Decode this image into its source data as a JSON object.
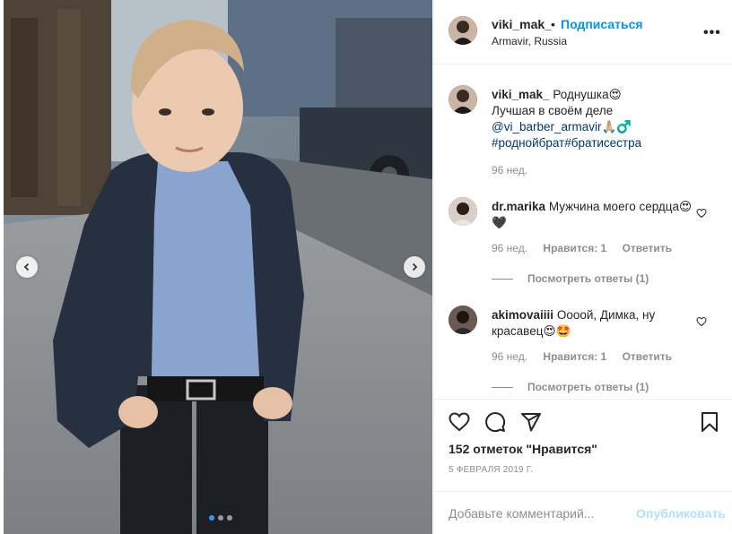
{
  "post": {
    "username": "viki_mak_",
    "separator": "•",
    "follow_label": "Подписаться",
    "location": "Armavir, Russia",
    "more_label": "•••"
  },
  "caption": {
    "username": "viki_mak_",
    "line1": "Роднушка😍",
    "line2": "Лучшая в своём деле",
    "mention": "@vi_barber_armavir",
    "mention_emoji": "🙏🏼♂️",
    "hashtags": "#роднойбрат#братисестра",
    "time": "96 нед."
  },
  "comments": [
    {
      "username": "dr.marika",
      "text": "Мужчина моего сердца😍🖤",
      "time": "96 нед.",
      "likes": "Нравится: 1",
      "reply": "Ответить",
      "view_replies": "Посмотреть ответы (1)"
    },
    {
      "username": "akimovaiiii",
      "text": "Оооой, Димка, ну красавец😍🤩",
      "time": "96 нед.",
      "likes": "Нравится: 1",
      "reply": "Ответить",
      "view_replies": "Посмотреть ответы (1)"
    }
  ],
  "stats": {
    "likes": "152 отметок \"Нравится\"",
    "date": "5 ФЕВРАЛЯ 2019 Г."
  },
  "composer": {
    "placeholder": "Добавьте комментарий...",
    "publish_label": "Опубликовать"
  },
  "carousel": {
    "current_slide": 1,
    "total_slides": 3
  },
  "colors": {
    "accent": "#0095f6",
    "publish_disabled": "#b2dffc",
    "muted": "#8e8e8e",
    "text": "#262626"
  },
  "icons": [
    "chevron-left-icon",
    "chevron-right-icon",
    "heart-icon",
    "comment-icon",
    "share-icon",
    "bookmark-icon",
    "more-icon"
  ]
}
